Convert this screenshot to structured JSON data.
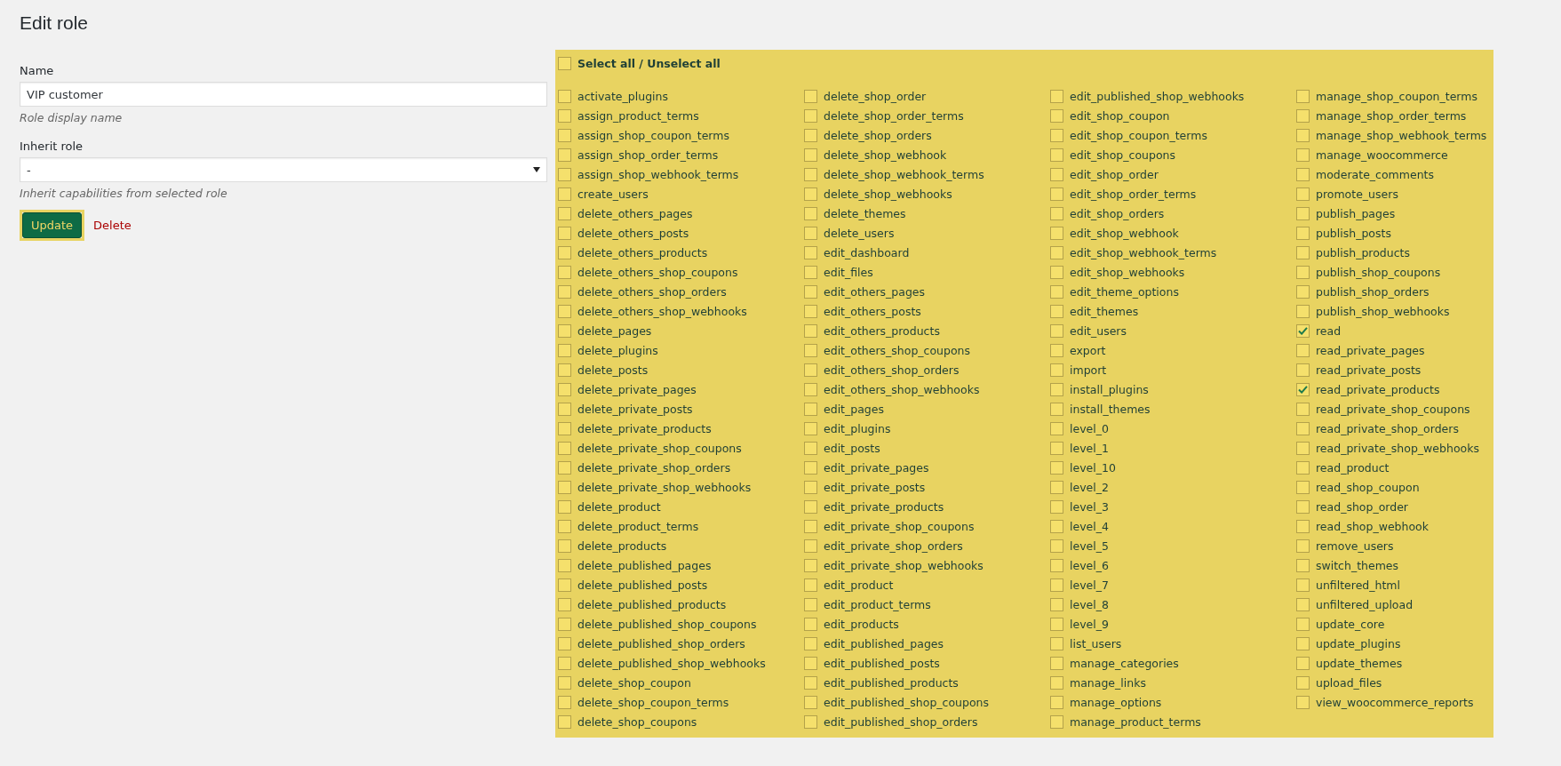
{
  "page_title": "Edit role",
  "name_field": {
    "label": "Name",
    "value": "VIP customer",
    "hint": "Role display name"
  },
  "inherit_field": {
    "label": "Inherit role",
    "value": "-",
    "hint": "Inherit capabilities from selected role"
  },
  "update_button": "Update",
  "delete_link": "Delete",
  "select_all": {
    "label": "Select all / Unselect all",
    "checked": false
  },
  "capabilities": [
    {
      "name": "activate_plugins",
      "checked": false
    },
    {
      "name": "assign_product_terms",
      "checked": false
    },
    {
      "name": "assign_shop_coupon_terms",
      "checked": false
    },
    {
      "name": "assign_shop_order_terms",
      "checked": false
    },
    {
      "name": "assign_shop_webhook_terms",
      "checked": false
    },
    {
      "name": "create_users",
      "checked": false
    },
    {
      "name": "delete_others_pages",
      "checked": false
    },
    {
      "name": "delete_others_posts",
      "checked": false
    },
    {
      "name": "delete_others_products",
      "checked": false
    },
    {
      "name": "delete_others_shop_coupons",
      "checked": false
    },
    {
      "name": "delete_others_shop_orders",
      "checked": false
    },
    {
      "name": "delete_others_shop_webhooks",
      "checked": false
    },
    {
      "name": "delete_pages",
      "checked": false
    },
    {
      "name": "delete_plugins",
      "checked": false
    },
    {
      "name": "delete_posts",
      "checked": false
    },
    {
      "name": "delete_private_pages",
      "checked": false
    },
    {
      "name": "delete_private_posts",
      "checked": false
    },
    {
      "name": "delete_private_products",
      "checked": false
    },
    {
      "name": "delete_private_shop_coupons",
      "checked": false
    },
    {
      "name": "delete_private_shop_orders",
      "checked": false
    },
    {
      "name": "delete_private_shop_webhooks",
      "checked": false
    },
    {
      "name": "delete_product",
      "checked": false
    },
    {
      "name": "delete_product_terms",
      "checked": false
    },
    {
      "name": "delete_products",
      "checked": false
    },
    {
      "name": "delete_published_pages",
      "checked": false
    },
    {
      "name": "delete_published_posts",
      "checked": false
    },
    {
      "name": "delete_published_products",
      "checked": false
    },
    {
      "name": "delete_published_shop_coupons",
      "checked": false
    },
    {
      "name": "delete_published_shop_orders",
      "checked": false
    },
    {
      "name": "delete_published_shop_webhooks",
      "checked": false
    },
    {
      "name": "delete_shop_coupon",
      "checked": false
    },
    {
      "name": "delete_shop_coupon_terms",
      "checked": false
    },
    {
      "name": "delete_shop_coupons",
      "checked": false
    },
    {
      "name": "delete_shop_order",
      "checked": false
    },
    {
      "name": "delete_shop_order_terms",
      "checked": false
    },
    {
      "name": "delete_shop_orders",
      "checked": false
    },
    {
      "name": "delete_shop_webhook",
      "checked": false
    },
    {
      "name": "delete_shop_webhook_terms",
      "checked": false
    },
    {
      "name": "delete_shop_webhooks",
      "checked": false
    },
    {
      "name": "delete_themes",
      "checked": false
    },
    {
      "name": "delete_users",
      "checked": false
    },
    {
      "name": "edit_dashboard",
      "checked": false
    },
    {
      "name": "edit_files",
      "checked": false
    },
    {
      "name": "edit_others_pages",
      "checked": false
    },
    {
      "name": "edit_others_posts",
      "checked": false
    },
    {
      "name": "edit_others_products",
      "checked": false
    },
    {
      "name": "edit_others_shop_coupons",
      "checked": false
    },
    {
      "name": "edit_others_shop_orders",
      "checked": false
    },
    {
      "name": "edit_others_shop_webhooks",
      "checked": false
    },
    {
      "name": "edit_pages",
      "checked": false
    },
    {
      "name": "edit_plugins",
      "checked": false
    },
    {
      "name": "edit_posts",
      "checked": false
    },
    {
      "name": "edit_private_pages",
      "checked": false
    },
    {
      "name": "edit_private_posts",
      "checked": false
    },
    {
      "name": "edit_private_products",
      "checked": false
    },
    {
      "name": "edit_private_shop_coupons",
      "checked": false
    },
    {
      "name": "edit_private_shop_orders",
      "checked": false
    },
    {
      "name": "edit_private_shop_webhooks",
      "checked": false
    },
    {
      "name": "edit_product",
      "checked": false
    },
    {
      "name": "edit_product_terms",
      "checked": false
    },
    {
      "name": "edit_products",
      "checked": false
    },
    {
      "name": "edit_published_pages",
      "checked": false
    },
    {
      "name": "edit_published_posts",
      "checked": false
    },
    {
      "name": "edit_published_products",
      "checked": false
    },
    {
      "name": "edit_published_shop_coupons",
      "checked": false
    },
    {
      "name": "edit_published_shop_orders",
      "checked": false
    },
    {
      "name": "edit_published_shop_webhooks",
      "checked": false
    },
    {
      "name": "edit_shop_coupon",
      "checked": false
    },
    {
      "name": "edit_shop_coupon_terms",
      "checked": false
    },
    {
      "name": "edit_shop_coupons",
      "checked": false
    },
    {
      "name": "edit_shop_order",
      "checked": false
    },
    {
      "name": "edit_shop_order_terms",
      "checked": false
    },
    {
      "name": "edit_shop_orders",
      "checked": false
    },
    {
      "name": "edit_shop_webhook",
      "checked": false
    },
    {
      "name": "edit_shop_webhook_terms",
      "checked": false
    },
    {
      "name": "edit_shop_webhooks",
      "checked": false
    },
    {
      "name": "edit_theme_options",
      "checked": false
    },
    {
      "name": "edit_themes",
      "checked": false
    },
    {
      "name": "edit_users",
      "checked": false
    },
    {
      "name": "export",
      "checked": false
    },
    {
      "name": "import",
      "checked": false
    },
    {
      "name": "install_plugins",
      "checked": false
    },
    {
      "name": "install_themes",
      "checked": false
    },
    {
      "name": "level_0",
      "checked": false
    },
    {
      "name": "level_1",
      "checked": false
    },
    {
      "name": "level_10",
      "checked": false
    },
    {
      "name": "level_2",
      "checked": false
    },
    {
      "name": "level_3",
      "checked": false
    },
    {
      "name": "level_4",
      "checked": false
    },
    {
      "name": "level_5",
      "checked": false
    },
    {
      "name": "level_6",
      "checked": false
    },
    {
      "name": "level_7",
      "checked": false
    },
    {
      "name": "level_8",
      "checked": false
    },
    {
      "name": "level_9",
      "checked": false
    },
    {
      "name": "list_users",
      "checked": false
    },
    {
      "name": "manage_categories",
      "checked": false
    },
    {
      "name": "manage_links",
      "checked": false
    },
    {
      "name": "manage_options",
      "checked": false
    },
    {
      "name": "manage_product_terms",
      "checked": false
    },
    {
      "name": "manage_shop_coupon_terms",
      "checked": false
    },
    {
      "name": "manage_shop_order_terms",
      "checked": false
    },
    {
      "name": "manage_shop_webhook_terms",
      "checked": false
    },
    {
      "name": "manage_woocommerce",
      "checked": false
    },
    {
      "name": "moderate_comments",
      "checked": false
    },
    {
      "name": "promote_users",
      "checked": false
    },
    {
      "name": "publish_pages",
      "checked": false
    },
    {
      "name": "publish_posts",
      "checked": false
    },
    {
      "name": "publish_products",
      "checked": false
    },
    {
      "name": "publish_shop_coupons",
      "checked": false
    },
    {
      "name": "publish_shop_orders",
      "checked": false
    },
    {
      "name": "publish_shop_webhooks",
      "checked": false
    },
    {
      "name": "read",
      "checked": true
    },
    {
      "name": "read_private_pages",
      "checked": false
    },
    {
      "name": "read_private_posts",
      "checked": false
    },
    {
      "name": "read_private_products",
      "checked": true
    },
    {
      "name": "read_private_shop_coupons",
      "checked": false
    },
    {
      "name": "read_private_shop_orders",
      "checked": false
    },
    {
      "name": "read_private_shop_webhooks",
      "checked": false
    },
    {
      "name": "read_product",
      "checked": false
    },
    {
      "name": "read_shop_coupon",
      "checked": false
    },
    {
      "name": "read_shop_order",
      "checked": false
    },
    {
      "name": "read_shop_webhook",
      "checked": false
    },
    {
      "name": "remove_users",
      "checked": false
    },
    {
      "name": "switch_themes",
      "checked": false
    },
    {
      "name": "unfiltered_html",
      "checked": false
    },
    {
      "name": "unfiltered_upload",
      "checked": false
    },
    {
      "name": "update_core",
      "checked": false
    },
    {
      "name": "update_plugins",
      "checked": false
    },
    {
      "name": "update_themes",
      "checked": false
    },
    {
      "name": "upload_files",
      "checked": false
    },
    {
      "name": "view_woocommerce_reports",
      "checked": false
    }
  ]
}
